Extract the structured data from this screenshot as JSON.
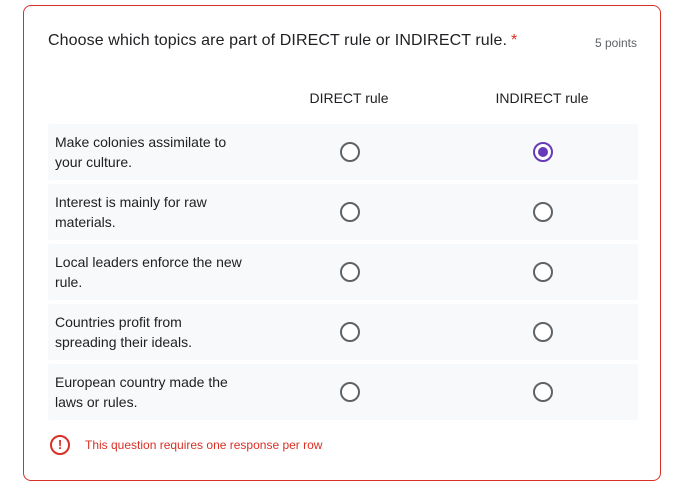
{
  "question": {
    "title": "Choose which topics are part of DIRECT rule or INDIRECT rule.",
    "required_mark": "*",
    "points": "5 points"
  },
  "columns": [
    "DIRECT rule",
    "INDIRECT rule"
  ],
  "rows": [
    {
      "label": "Make colonies assimilate to your culture.",
      "selected": "INDIRECT rule"
    },
    {
      "label": "Interest is mainly for raw materials.",
      "selected": null
    },
    {
      "label": "Local leaders enforce the new rule.",
      "selected": null
    },
    {
      "label": "Countries profit from spreading their ideals.",
      "selected": null
    },
    {
      "label": "European country made the laws or rules.",
      "selected": null
    }
  ],
  "error": {
    "icon": "error-icon",
    "icon_glyph": "!",
    "message": "This question requires one response per row"
  },
  "colors": {
    "accent": "#673ab7",
    "error": "#d93025"
  }
}
